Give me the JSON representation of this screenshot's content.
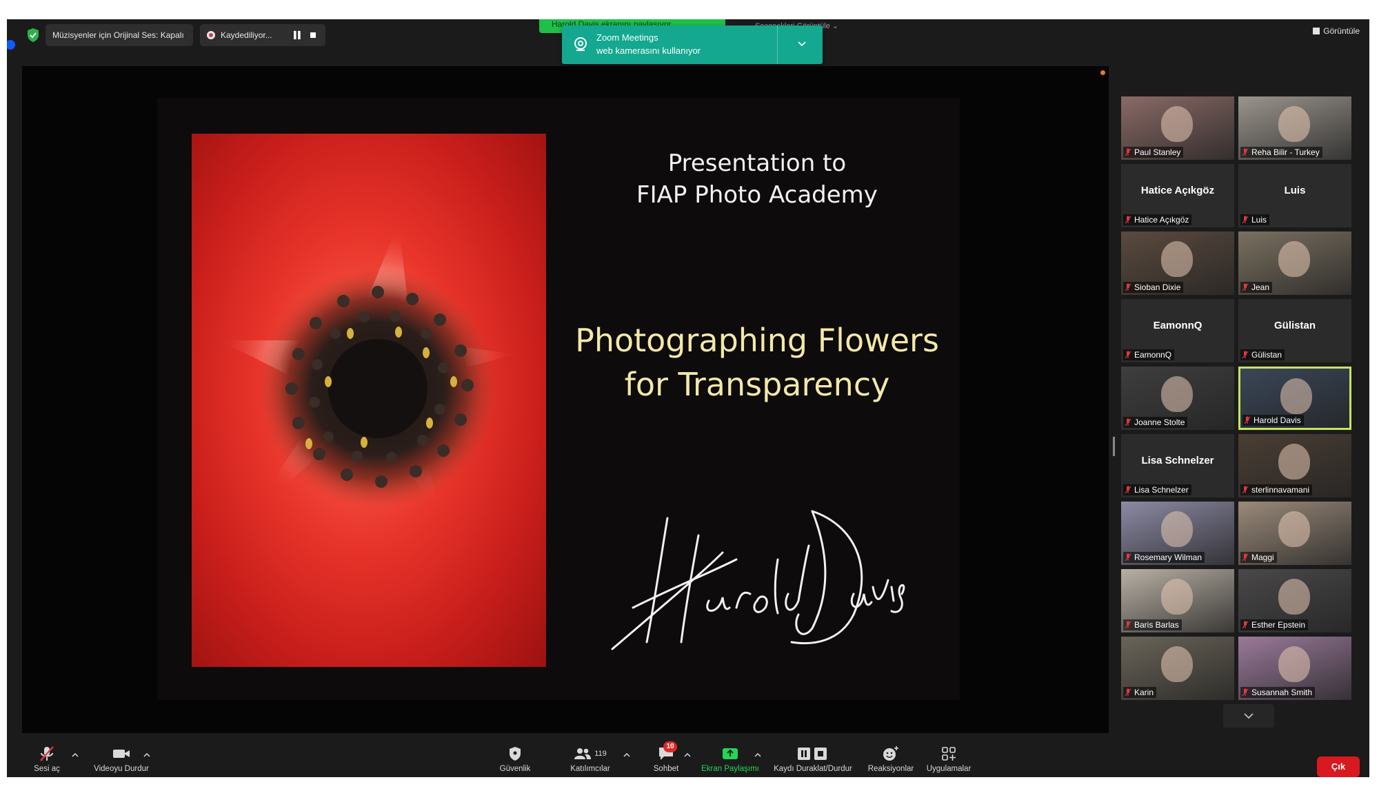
{
  "topbar": {
    "audio_status": "Müzisyenler için Orijinal Ses: Kapalı",
    "recording_label": "Kaydediliyor...",
    "share_banner": "Harold Davis ekranını paylaşıyor",
    "view_options": "Seçenekleri Görüntüle",
    "view_button": "Görüntüle"
  },
  "toast": {
    "app": "Zoom Meetings",
    "message": "web kamerasını kullanıyor"
  },
  "slide": {
    "title_line1": "Presentation to",
    "title_line2": "FIAP Photo Academy",
    "heading_line1": "Photographing Flowers",
    "heading_line2": "for Transparency"
  },
  "participants": [
    {
      "name": "Paul Stanley",
      "type": "video",
      "bg": "#8a6a66"
    },
    {
      "name": "Reha Bilir - Turkey",
      "type": "video",
      "bg": "#9a948c"
    },
    {
      "name": "Hatice Açıkgöz",
      "type": "name"
    },
    {
      "name": "Luis",
      "type": "name"
    },
    {
      "name": "Sioban Dixie",
      "type": "video",
      "bg": "#5a4a3e"
    },
    {
      "name": "Jean",
      "type": "video",
      "bg": "#7a7060"
    },
    {
      "name": "EamonnQ",
      "type": "name"
    },
    {
      "name": "Gülistan",
      "type": "name"
    },
    {
      "name": "Joanne Stolte",
      "type": "video",
      "bg": "#3e3e3e"
    },
    {
      "name": "Harold Davis",
      "type": "video",
      "bg": "#3a4658",
      "active": true
    },
    {
      "name": "Lisa Schnelzer",
      "type": "name"
    },
    {
      "name": "sterlinnavamani",
      "type": "video",
      "bg": "#4a3e34"
    },
    {
      "name": "Rosemary Wilman",
      "type": "video",
      "bg": "#8c8aa4"
    },
    {
      "name": "Maggi",
      "type": "video",
      "bg": "#9a8a7a"
    },
    {
      "name": "Baris Barlas",
      "type": "video",
      "bg": "#b8b0a4"
    },
    {
      "name": "Esther Epstein",
      "type": "video",
      "bg": "#4a4848"
    },
    {
      "name": "Karin",
      "type": "video",
      "bg": "#6a6458"
    },
    {
      "name": "Susannah Smith",
      "type": "video",
      "bg": "#9a7a9a"
    }
  ],
  "toolbar": {
    "unmute": "Sesi aç",
    "stop_video": "Videoyu Durdur",
    "security": "Güvenlik",
    "participants": "Katılımcılar",
    "participant_count": "119",
    "chat": "Sohbet",
    "chat_badge": "10",
    "share": "Ekran Paylaşımı",
    "record": "Kaydı Duraklat/Durdur",
    "reactions": "Reaksiyonlar",
    "apps": "Uygulamalar",
    "leave": "Çık"
  },
  "colors": {
    "share_green": "#1fbf4a",
    "toast_teal": "#13a88f",
    "leave_red": "#d9181f",
    "active_speaker": "#c7e462",
    "mute_red": "#e0393e"
  }
}
